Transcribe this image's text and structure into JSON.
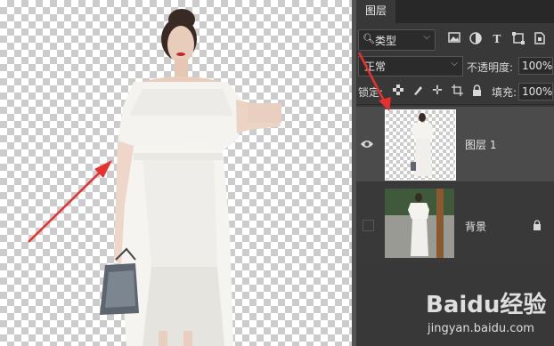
{
  "panel": {
    "tab_label": "图层",
    "filter": {
      "label": "类型",
      "icon": "search-icon"
    },
    "blend_mode": "正常",
    "opacity_label": "不透明度:",
    "opacity_value": "100%",
    "lock_label": "锁定:",
    "fill_label": "填充:",
    "fill_value": "100%",
    "layers": [
      {
        "name": "图层 1",
        "visible": true,
        "selected": true,
        "transparent_thumbnail": true
      },
      {
        "name": "背景",
        "visible": false,
        "selected": false,
        "locked": true
      }
    ]
  },
  "watermark": {
    "logo": "Baidu经验",
    "url": "jingyan.baidu.com"
  },
  "annotations": {
    "arrow_color": "#e8312f",
    "arrow_count": 2
  },
  "colors": {
    "panel_bg": "#383838",
    "selected_layer": "#4b4b4b",
    "tab_bar": "#282828"
  }
}
